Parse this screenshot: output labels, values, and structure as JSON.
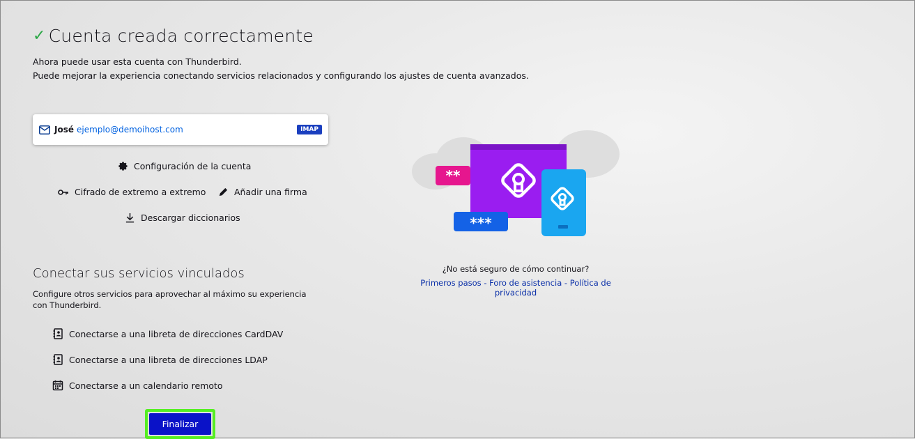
{
  "header": {
    "title": "Cuenta creada correctamente",
    "line1": "Ahora puede usar esta cuenta con Thunderbird.",
    "line2": "Puede mejorar la experiencia conectando servicios relacionados y configurando los ajustes de cuenta avanzados."
  },
  "account": {
    "name": "José",
    "email": "ejemplo@demoihost.com",
    "protocol": "IMAP"
  },
  "actions": {
    "account_settings": "Configuración de la cuenta",
    "e2e_encryption": "Cifrado de extremo a extremo",
    "add_signature": "Añadir una firma",
    "download_dictionaries": "Descargar diccionarios"
  },
  "linked_services": {
    "title": "Conectar sus servicios vinculados",
    "description": "Configure otros servicios para aprovechar al máximo su experiencia con Thunderbird.",
    "items": [
      {
        "label": "Conectarse a una libreta de direcciones CardDAV",
        "icon": "address-book-icon"
      },
      {
        "label": "Conectarse a una libreta de direcciones LDAP",
        "icon": "address-book-icon"
      },
      {
        "label": "Conectarse a un calendario remoto",
        "icon": "calendar-icon"
      }
    ]
  },
  "finish_button": "Finalizar",
  "help": {
    "question": "¿No está seguro de cómo continuar?",
    "link1": "Primeros pasos",
    "sep1": " - ",
    "link2": "Foro de asistencia",
    "sep2": " - ",
    "link3": "Política de privacidad"
  },
  "illustration": {
    "password_short": "**",
    "password_long": "***"
  },
  "colors": {
    "accent": "#0a12c8",
    "link": "#0061e0",
    "success": "#2aa745",
    "highlight": "#55ee22"
  }
}
